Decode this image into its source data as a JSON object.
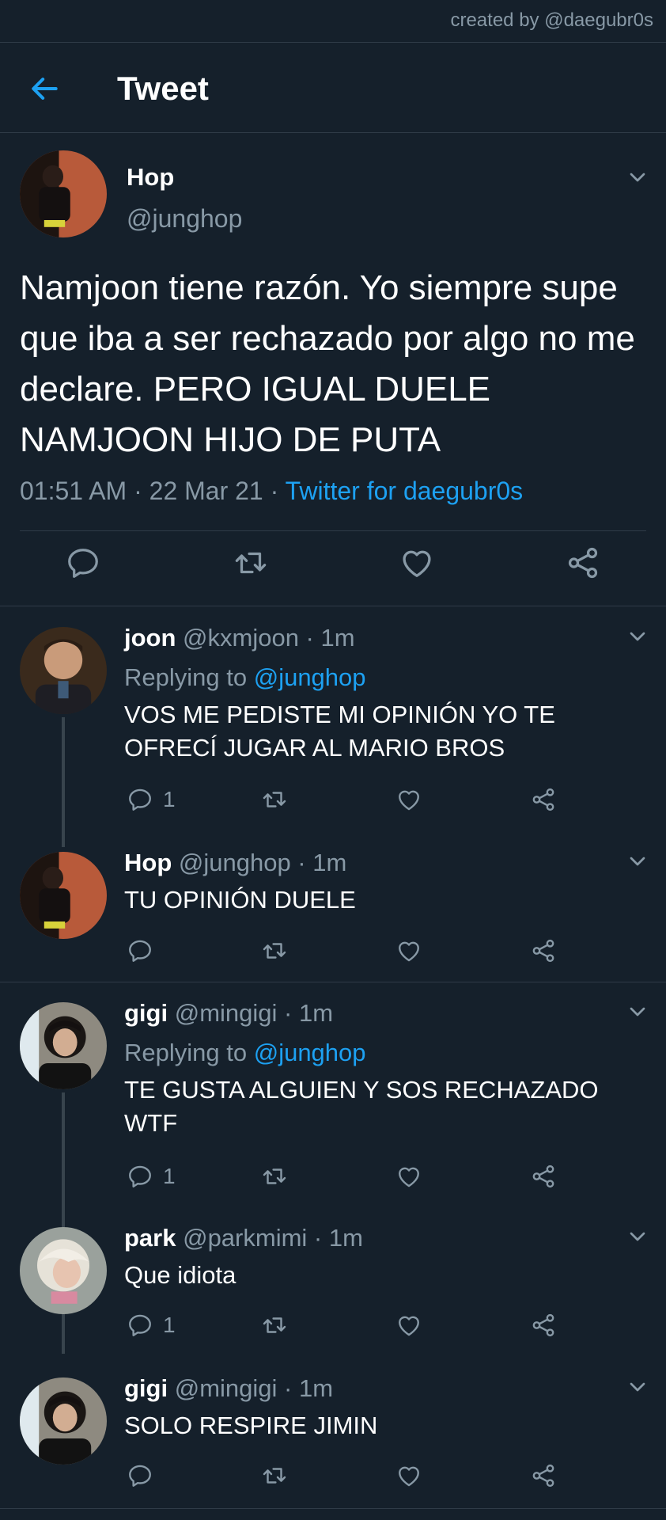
{
  "credit": "created by @daegubr0s",
  "header": {
    "title": "Tweet"
  },
  "main_tweet": {
    "name": "Hop",
    "handle": "@junghop",
    "text": "Namjoon tiene razón. Yo siempre supe que iba a ser rechazado por algo no me declare. PERO IGUAL DUELE NAMJOON HIJO DE PUTA",
    "time": "01:51 AM · 22 Mar 21 · ",
    "source": "Twitter for daegubr0s"
  },
  "replies": [
    {
      "name": "joon",
      "meta": " @kxmjoon · 1m",
      "replying_prefix": "Replying to ",
      "replying_to": "@junghop",
      "text": "VOS ME PEDISTE MI OPINIÓN YO TE OFRECÍ JUGAR AL MARIO BROS",
      "reply_count": "1"
    },
    {
      "name": "Hop",
      "meta": " @junghop · 1m",
      "text": "TU OPINIÓN DUELE",
      "reply_count": ""
    },
    {
      "name": "gigi",
      "meta": " @mingigi · 1m",
      "replying_prefix": "Replying to ",
      "replying_to": "@junghop",
      "text": "TE GUSTA ALGUIEN Y SOS RECHAZADO WTF",
      "reply_count": "1"
    },
    {
      "name": "park",
      "meta": " @parkmimi · 1m",
      "text": "Que idiota",
      "reply_count": "1"
    },
    {
      "name": "gigi",
      "meta": " @mingigi · 1m",
      "text": "SOLO RESPIRE JIMIN",
      "reply_count": ""
    }
  ],
  "colors": {
    "background": "#15202b",
    "accent": "#1da1f2",
    "muted": "#8899a6",
    "border": "#2f3b47"
  },
  "icons": [
    "back-arrow-icon",
    "chevron-down-icon",
    "reply-icon",
    "retweet-icon",
    "like-icon",
    "share-icon"
  ]
}
